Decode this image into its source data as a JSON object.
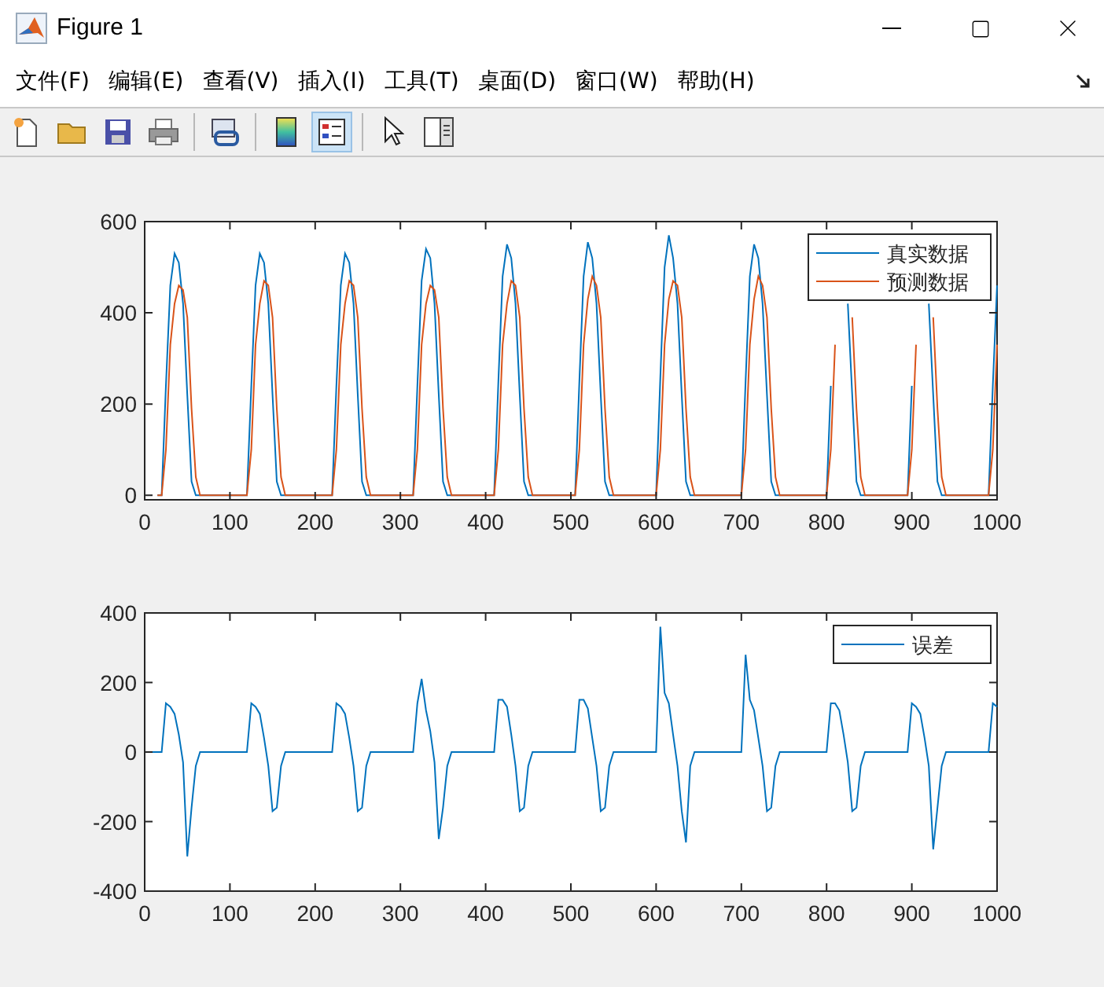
{
  "window": {
    "title": "Figure 1"
  },
  "menu": [
    "文件(F)",
    "编辑(E)",
    "查看(V)",
    "插入(I)",
    "工具(T)",
    "桌面(D)",
    "窗口(W)",
    "帮助(H)"
  ],
  "toolbar": [
    {
      "kind": "new",
      "selected": false
    },
    {
      "kind": "open",
      "selected": false
    },
    {
      "kind": "save",
      "selected": false
    },
    {
      "kind": "print",
      "selected": false
    },
    {
      "kind": "sep"
    },
    {
      "kind": "link",
      "selected": false
    },
    {
      "kind": "sep"
    },
    {
      "kind": "colorbar",
      "selected": false
    },
    {
      "kind": "legend",
      "selected": true
    },
    {
      "kind": "sep"
    },
    {
      "kind": "pointer",
      "selected": false
    },
    {
      "kind": "panel",
      "selected": false
    }
  ],
  "plots": [
    {
      "chart_data": {
        "type": "line",
        "legend": true,
        "x": [
          15,
          20,
          25,
          30,
          35,
          40,
          45,
          50,
          55,
          60,
          65,
          70,
          75,
          80,
          85,
          90,
          95,
          100,
          105,
          110,
          115,
          120,
          125,
          130,
          135,
          140,
          145,
          150,
          155,
          160,
          165,
          170,
          175,
          180,
          185,
          190,
          195,
          200,
          205,
          210,
          215,
          220,
          225,
          230,
          235,
          240,
          245,
          250,
          255,
          260,
          265,
          270,
          275,
          280,
          285,
          290,
          295,
          300,
          305,
          310,
          315,
          320,
          325,
          330,
          335,
          340,
          345,
          350,
          355,
          360,
          365,
          370,
          375,
          380,
          385,
          390,
          395,
          400,
          405,
          410,
          415,
          420,
          425,
          430,
          435,
          440,
          445,
          450,
          455,
          460,
          465,
          470,
          475,
          480,
          485,
          490,
          495,
          500,
          505,
          510,
          515,
          520,
          525,
          530,
          535,
          540,
          545,
          550,
          555,
          560,
          565,
          570,
          575,
          580,
          585,
          590,
          595,
          600,
          605,
          610,
          615,
          620,
          625,
          630,
          635,
          640,
          645,
          650,
          655,
          660,
          665,
          670,
          675,
          680,
          685,
          690,
          695,
          700,
          705,
          710,
          715,
          720,
          725,
          730,
          735,
          740,
          745,
          750,
          755,
          760,
          765,
          770,
          775,
          780,
          785,
          790,
          795,
          800,
          805,
          810,
          815,
          820,
          825,
          830,
          835,
          840,
          845,
          850,
          855,
          860,
          865,
          870,
          875,
          880,
          885,
          890,
          895,
          900,
          905,
          910,
          915,
          920,
          925,
          930,
          935,
          940,
          945,
          950,
          955,
          960,
          965,
          970,
          975,
          980,
          985,
          990,
          995,
          1000
        ],
        "series": [
          {
            "name": "真实数据",
            "color": "#0072bd",
            "values": [
              0,
              0,
              240,
              460,
              530,
              510,
              420,
              220,
              30,
              0,
              0,
              0,
              0,
              0,
              0,
              0,
              0,
              0,
              0,
              0,
              0,
              0,
              240,
              460,
              530,
              510,
              420,
              220,
              30,
              0,
              0,
              0,
              0,
              0,
              0,
              0,
              0,
              0,
              0,
              0,
              0,
              0,
              240,
              460,
              530,
              510,
              420,
              220,
              30,
              0,
              0,
              0,
              0,
              0,
              0,
              0,
              0,
              0,
              0,
              0,
              0,
              240,
              470,
              540,
              520,
              420,
              220,
              30,
              0,
              0,
              0,
              0,
              0,
              0,
              0,
              0,
              0,
              0,
              0,
              0,
              250,
              480,
              550,
              520,
              420,
              220,
              30,
              0,
              0,
              0,
              0,
              0,
              0,
              0,
              0,
              0,
              0,
              0,
              0,
              250,
              480,
              555,
              520,
              420,
              220,
              30,
              0,
              0,
              0,
              0,
              0,
              0,
              0,
              0,
              0,
              0,
              0,
              0,
              260,
              500,
              570,
              520,
              420,
              220,
              30,
              0,
              0,
              0,
              0,
              0,
              0,
              0,
              0,
              0,
              0,
              0,
              0,
              0,
              250,
              480,
              550,
              520,
              420,
              220,
              30,
              0,
              0,
              0,
              0,
              0,
              0,
              0,
              0,
              0,
              0,
              0,
              0,
              0,
              240,
              null,
              null,
              null,
              420,
              220,
              30,
              0,
              0,
              0,
              0,
              0,
              0,
              0,
              0,
              0,
              0,
              0,
              0,
              240,
              null,
              null,
              null,
              420,
              220,
              30,
              0,
              0,
              0,
              0,
              0,
              0,
              0,
              0,
              0,
              0,
              0,
              0,
              240,
              460
            ]
          },
          {
            "name": "预测数据",
            "color": "#d95319",
            "values": [
              0,
              0,
              100,
              330,
              420,
              460,
              450,
              390,
              190,
              40,
              0,
              0,
              0,
              0,
              0,
              0,
              0,
              0,
              0,
              0,
              0,
              0,
              100,
              330,
              420,
              470,
              460,
              390,
              190,
              40,
              0,
              0,
              0,
              0,
              0,
              0,
              0,
              0,
              0,
              0,
              0,
              0,
              100,
              330,
              420,
              470,
              460,
              390,
              190,
              40,
              0,
              0,
              0,
              0,
              0,
              0,
              0,
              0,
              0,
              0,
              0,
              100,
              330,
              420,
              460,
              450,
              390,
              190,
              40,
              0,
              0,
              0,
              0,
              0,
              0,
              0,
              0,
              0,
              0,
              0,
              100,
              330,
              420,
              470,
              460,
              390,
              190,
              40,
              0,
              0,
              0,
              0,
              0,
              0,
              0,
              0,
              0,
              0,
              0,
              100,
              330,
              430,
              480,
              460,
              390,
              190,
              40,
              0,
              0,
              0,
              0,
              0,
              0,
              0,
              0,
              0,
              0,
              0,
              100,
              330,
              430,
              470,
              460,
              390,
              190,
              40,
              0,
              0,
              0,
              0,
              0,
              0,
              0,
              0,
              0,
              0,
              0,
              0,
              100,
              330,
              430,
              480,
              460,
              390,
              190,
              40,
              0,
              0,
              0,
              0,
              0,
              0,
              0,
              0,
              0,
              0,
              0,
              0,
              100,
              330,
              null,
              null,
              null,
              390,
              190,
              40,
              0,
              0,
              0,
              0,
              0,
              0,
              0,
              0,
              0,
              0,
              0,
              100,
              330,
              null,
              null,
              null,
              390,
              190,
              40,
              0,
              0,
              0,
              0,
              0,
              0,
              0,
              0,
              0,
              0,
              0,
              100,
              330
            ]
          }
        ],
        "xlim": [
          0,
          1000
        ],
        "ylim": [
          -10,
          600
        ],
        "xticks": [
          0,
          100,
          200,
          300,
          400,
          500,
          600,
          700,
          800,
          900,
          1000
        ],
        "yticks": [
          0,
          200,
          400,
          600
        ]
      }
    },
    {
      "chart_data": {
        "type": "line",
        "legend": true,
        "x": [
          5,
          10,
          15,
          20,
          25,
          30,
          35,
          40,
          45,
          50,
          55,
          60,
          65,
          70,
          75,
          80,
          85,
          90,
          95,
          100,
          105,
          110,
          115,
          120,
          125,
          130,
          135,
          140,
          145,
          150,
          155,
          160,
          165,
          170,
          175,
          180,
          185,
          190,
          195,
          200,
          205,
          210,
          215,
          220,
          225,
          230,
          235,
          240,
          245,
          250,
          255,
          260,
          265,
          270,
          275,
          280,
          285,
          290,
          295,
          300,
          305,
          310,
          315,
          320,
          325,
          330,
          335,
          340,
          345,
          350,
          355,
          360,
          365,
          370,
          375,
          380,
          385,
          390,
          395,
          400,
          405,
          410,
          415,
          420,
          425,
          430,
          435,
          440,
          445,
          450,
          455,
          460,
          465,
          470,
          475,
          480,
          485,
          490,
          495,
          500,
          505,
          510,
          515,
          520,
          525,
          530,
          535,
          540,
          545,
          550,
          555,
          560,
          565,
          570,
          575,
          580,
          585,
          590,
          595,
          600,
          605,
          610,
          615,
          620,
          625,
          630,
          635,
          640,
          645,
          650,
          655,
          660,
          665,
          670,
          675,
          680,
          685,
          690,
          695,
          700,
          705,
          710,
          715,
          720,
          725,
          730,
          735,
          740,
          745,
          750,
          755,
          760,
          765,
          770,
          775,
          780,
          785,
          790,
          795,
          800,
          805,
          810,
          815,
          820,
          825,
          830,
          835,
          840,
          845,
          850,
          855,
          860,
          865,
          870,
          875,
          880,
          885,
          890,
          895,
          900,
          905,
          910,
          915,
          920,
          925,
          930,
          935,
          940,
          945,
          950,
          955,
          960,
          965,
          970,
          975,
          980,
          985,
          990,
          995,
          1000
        ],
        "series": [
          {
            "name": "误差",
            "color": "#0072bd",
            "values": [
              0,
              0,
              0,
              0,
              140,
              130,
              110,
              50,
              -30,
              -300,
              -160,
              -40,
              0,
              0,
              0,
              0,
              0,
              0,
              0,
              0,
              0,
              0,
              0,
              0,
              140,
              130,
              110,
              40,
              -40,
              -170,
              -160,
              -40,
              0,
              0,
              0,
              0,
              0,
              0,
              0,
              0,
              0,
              0,
              0,
              0,
              140,
              130,
              110,
              40,
              -40,
              -170,
              -160,
              -40,
              0,
              0,
              0,
              0,
              0,
              0,
              0,
              0,
              0,
              0,
              0,
              140,
              210,
              120,
              60,
              -30,
              -250,
              -160,
              -40,
              0,
              0,
              0,
              0,
              0,
              0,
              0,
              0,
              0,
              0,
              0,
              150,
              150,
              130,
              50,
              -40,
              -170,
              -160,
              -40,
              0,
              0,
              0,
              0,
              0,
              0,
              0,
              0,
              0,
              0,
              0,
              150,
              150,
              125,
              40,
              -40,
              -170,
              -160,
              -40,
              0,
              0,
              0,
              0,
              0,
              0,
              0,
              0,
              0,
              0,
              0,
              360,
              170,
              140,
              50,
              -40,
              -170,
              -260,
              -40,
              0,
              0,
              0,
              0,
              0,
              0,
              0,
              0,
              0,
              0,
              0,
              0,
              280,
              150,
              120,
              40,
              -40,
              -170,
              -160,
              -40,
              0,
              0,
              0,
              0,
              0,
              0,
              0,
              0,
              0,
              0,
              0,
              0,
              140,
              140,
              120,
              50,
              -30,
              -170,
              -160,
              -40,
              0,
              0,
              0,
              0,
              0,
              0,
              0,
              0,
              0,
              0,
              0,
              140,
              130,
              110,
              40,
              -40,
              -280,
              -160,
              -40,
              0,
              0,
              0,
              0,
              0,
              0,
              0,
              0,
              0,
              0,
              0,
              140,
              130
            ]
          }
        ],
        "xlim": [
          0,
          1000
        ],
        "ylim": [
          -400,
          400
        ],
        "xticks": [
          0,
          100,
          200,
          300,
          400,
          500,
          600,
          700,
          800,
          900,
          1000
        ],
        "yticks": [
          -400,
          -200,
          0,
          200,
          400
        ]
      }
    }
  ]
}
